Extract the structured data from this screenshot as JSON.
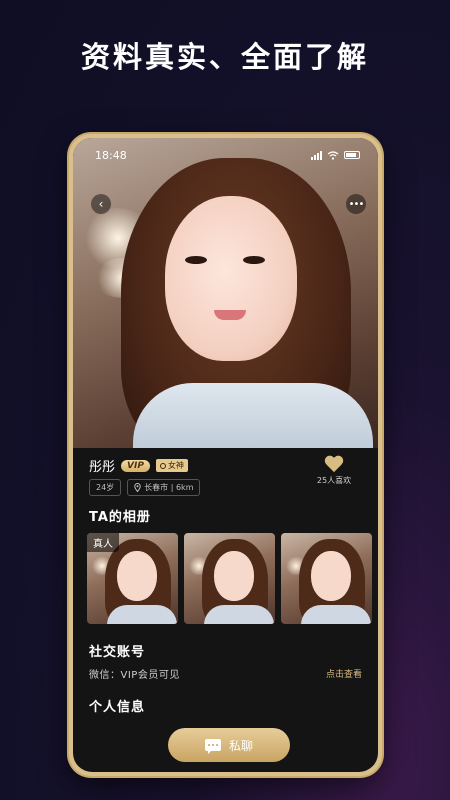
{
  "promo": {
    "headline": "资料真实、全面了解"
  },
  "status_bar": {
    "time": "18:48"
  },
  "profile": {
    "name": "彤彤",
    "vip_label": "VIP",
    "goddess_label": "女神",
    "age": "24岁",
    "location": "长春市 | 6km",
    "likes": "25人喜欢"
  },
  "album": {
    "title": "TA的相册",
    "real_tag": "真人"
  },
  "social": {
    "title": "社交账号",
    "wechat_text": "微信：VIP会员可见",
    "view_link": "点击查看"
  },
  "personal": {
    "title": "个人信息"
  },
  "actions": {
    "chat_label": "私聊"
  },
  "colors": {
    "gold": "#d9bc82",
    "frame": "#d9bf8c",
    "screen_bg": "#141414"
  },
  "icons": [
    "back-icon",
    "more-icon",
    "signal-icon",
    "wifi-icon",
    "battery-icon",
    "location-pin-icon",
    "heart-icon",
    "chat-bubble-icon"
  ]
}
